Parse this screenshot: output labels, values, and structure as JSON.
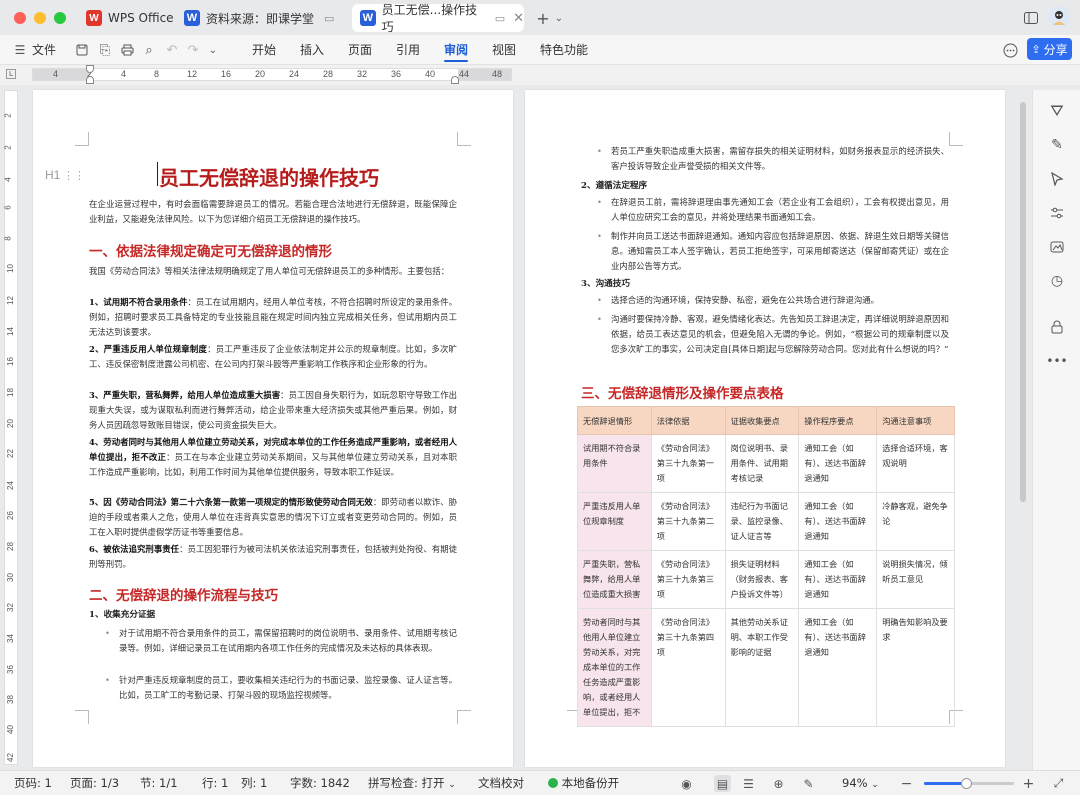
{
  "tabs": [
    {
      "label": "WPS Office",
      "icon": "wps-logo-icon"
    },
    {
      "label": "资料来源：即课学堂",
      "icon": "word-doc-icon"
    },
    {
      "label": "员工无偿...操作技巧",
      "icon": "word-doc-icon"
    }
  ],
  "menu": {
    "file": "文件",
    "items": [
      "开始",
      "插入",
      "页面",
      "引用",
      "审阅",
      "视图",
      "特色功能"
    ],
    "active": "审阅",
    "share": "分享"
  },
  "ruler": {
    "h_labels": [
      "4",
      "2",
      "4",
      "8",
      "12",
      "16",
      "20",
      "24",
      "28",
      "32",
      "36",
      "40",
      "44",
      "48"
    ],
    "v_labels": [
      "2",
      "2",
      "4",
      "6",
      "8",
      "10",
      "12",
      "14",
      "16",
      "18",
      "20",
      "22",
      "24",
      "26",
      "28",
      "30",
      "32",
      "34",
      "36",
      "38",
      "40",
      "42"
    ]
  },
  "document": {
    "title": "员工无偿辞退的操作技巧",
    "heading_mark": "H1",
    "intro": "在企业运营过程中，有时会面临需要辞退员工的情况。若能合理合法地进行无偿辞退，既能保障企业利益，又能避免法律风险。以下为您详细介绍员工无偿辞退的操作技巧。",
    "section1": {
      "title": "一、依据法律规定确定可无偿辞退的情形",
      "intro": "我国《劳动合同法》等相关法律法规明确规定了用人单位可无偿辞退员工的多种情形。主要包括：",
      "items": [
        {
          "head": "1、试用期不符合录用条件",
          "body": "：员工在试用期内，经用人单位考核，不符合招聘时所设定的录用条件。例如，招聘时要求员工具备特定的专业技能且能在规定时间内独立完成相关任务，但试用期内员工无法达到该要求。"
        },
        {
          "head": "2、严重违反用人单位规章制度",
          "body": "：员工严重违反了企业依法制定并公示的规章制度。比如，多次旷工、违反保密制度泄露公司机密、在公司内打架斗殴等严重影响工作秩序和企业形象的行为。"
        },
        {
          "head": "3、严重失职，营私舞弊，给用人单位造成重大损害",
          "body": "：员工因自身失职行为，如玩忽职守导致工作出现重大失误，或为谋取私利而进行舞弊活动，给企业带来重大经济损失或其他严重后果。例如，财务人员因疏忽导致账目错误，使公司资金损失巨大。"
        },
        {
          "head": "4、劳动者同时与其他用人单位建立劳动关系，对完成本单位的工作任务造成严重影响，或者经用人单位提出，拒不改正",
          "body": "：员工在与本企业建立劳动关系期间，又与其他单位建立劳动关系，且对本职工作造成严重影响，比如，利用工作时间为其他单位提供服务，导致本职工作延误。"
        },
        {
          "head": "5、因《劳动合同法》第二十六条第一款第一项规定的情形致使劳动合同无效",
          "body": "：即劳动者以欺诈、胁迫的手段或者乘人之危，使用人单位在违背真实意思的情况下订立或者变更劳动合同的。例如，员工在入职时提供虚假学历证书等重要信息。"
        },
        {
          "head": "6、被依法追究刑事责任",
          "body": "：员工因犯罪行为被司法机关依法追究刑事责任，包括被判处拘役、有期徒刑等刑罚。"
        }
      ]
    },
    "section2": {
      "title": "二、无偿辞退的操作流程与技巧",
      "step1": {
        "title": "1、收集充分证据",
        "bullets": [
          "对于试用期不符合录用条件的员工，需保留招聘时的岗位说明书、录用条件、试用期考核记录等。例如，详细记录员工在试用期内各项工作任务的完成情况及未达标的具体表现。",
          "针对严重违反规章制度的员工，要收集相关违纪行为的书面记录、监控录像、证人证言等。比如，员工旷工的考勤记录、打架斗殴的现场监控视频等。",
          "若员工严重失职造成重大损害，需留存损失的相关证明材料，如财务报表显示的经济损失、客户投诉导致企业声誉受损的相关文件等。"
        ]
      },
      "step2": {
        "title": "2、遵循法定程序",
        "bullets": [
          "在辞退员工前，需将辞退理由事先通知工会（若企业有工会组织），工会有权提出意见，用人单位应研究工会的意见，并将处理结果书面通知工会。",
          "制作并向员工送达书面辞退通知。通知内容应包括辞退原因、依据、辞退生效日期等关键信息。通知需员工本人签字确认，若员工拒绝签字，可采用邮寄送达（保留邮寄凭证）或在企业内部公告等方式。"
        ]
      },
      "step3": {
        "title": "3、沟通技巧",
        "bullets": [
          "选择合适的沟通环境，保持安静、私密，避免在公共场合进行辞退沟通。",
          "沟通时要保持冷静、客观，避免情绪化表达。先告知员工辞退决定，再详细说明辞退原因和依据，给员工表达意见的机会，但避免陷入无谓的争论。例如，“根据公司的规章制度以及您多次旷工的事实，公司决定自[具体日期]起与您解除劳动合同。您对此有什么想说的吗？”"
        ]
      }
    },
    "section3": {
      "title": "三、无偿辞退情形及操作要点表格",
      "headers": [
        "无偿辞退情形",
        "法律依据",
        "证据收集要点",
        "操作程序要点",
        "沟通注意事项"
      ],
      "rows": [
        [
          "试用期不符合录用条件",
          "《劳动合同法》第三十九条第一项",
          "岗位说明书、录用条件、试用期考核记录",
          "通知工会（如有）、送达书面辞退通知",
          "选择合适环境，客观说明"
        ],
        [
          "严重违反用人单位规章制度",
          "《劳动合同法》第三十九条第二项",
          "违纪行为书面记录、监控录像、证人证言等",
          "通知工会（如有）、送达书面辞退通知",
          "冷静客观，避免争论"
        ],
        [
          "严重失职，营私舞弊，给用人单位造成重大损害",
          "《劳动合同法》第三十九条第三项",
          "损失证明材料（财务报表、客户投诉文件等）",
          "通知工会（如有）、送达书面辞退通知",
          "说明损失情况，倾听员工意见"
        ],
        [
          "劳动者同时与其他用人单位建立劳动关系，对完成本单位的工作任务造成严重影响，或者经用人单位提出，拒不",
          "《劳动合同法》第三十九条第四项",
          "其他劳动关系证明、本职工作受影响的证据",
          "通知工会（如有）、送达书面辞退通知",
          "明确告知影响及要求"
        ]
      ]
    }
  },
  "status": {
    "page_code": "页码: 1",
    "pages": "页面: 1/3",
    "section": "节: 1/1",
    "row": "行: 1",
    "col": "列: 1",
    "word_count": "字数: 1842",
    "spell_check": "拼写检查: 打开",
    "proofread": "文档校对",
    "backup": "本地备份开",
    "zoom": "94%",
    "zoom_fraction": 0.47
  },
  "colors": {
    "accent": "#1f5fd6",
    "title_red": "#b71c1c",
    "heading_red": "#c62828",
    "table_header": "#f7d7c2",
    "table_first_col": "#f7e4ec"
  }
}
